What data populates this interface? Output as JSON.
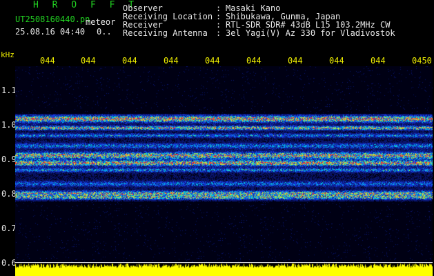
{
  "header": {
    "title": "H R O F F T",
    "filename": "UT2508160440.pn",
    "meteor_label": "meteor",
    "datetime": "25.08.16 04:40",
    "count": "0.."
  },
  "info": [
    {
      "label": "Observer",
      "value": "Masaki Kano"
    },
    {
      "label": "Receiving Location",
      "value": "Shibukawa, Gunma, Japan"
    },
    {
      "label": "Receiver",
      "value": "RTL-SDR SDR# 43dB L15 103.2MHz CW"
    },
    {
      "label": "Receiving Antenna",
      "value": "3el Yagi(V) Az 330 for Vladivostok"
    }
  ],
  "axis": {
    "unit": "kHz",
    "time_ticks": [
      "044",
      "044",
      "044",
      "044",
      "044",
      "044",
      "044",
      "044",
      "044",
      "0450"
    ],
    "freq_ticks": [
      "1.1",
      "1.0",
      "0.9",
      "0.8",
      "0.7",
      "0.6"
    ]
  },
  "colors": {
    "background": "#000000",
    "text_white": "#e8e8e8",
    "text_green": "#22d422",
    "text_yellow": "#f0f000"
  }
}
